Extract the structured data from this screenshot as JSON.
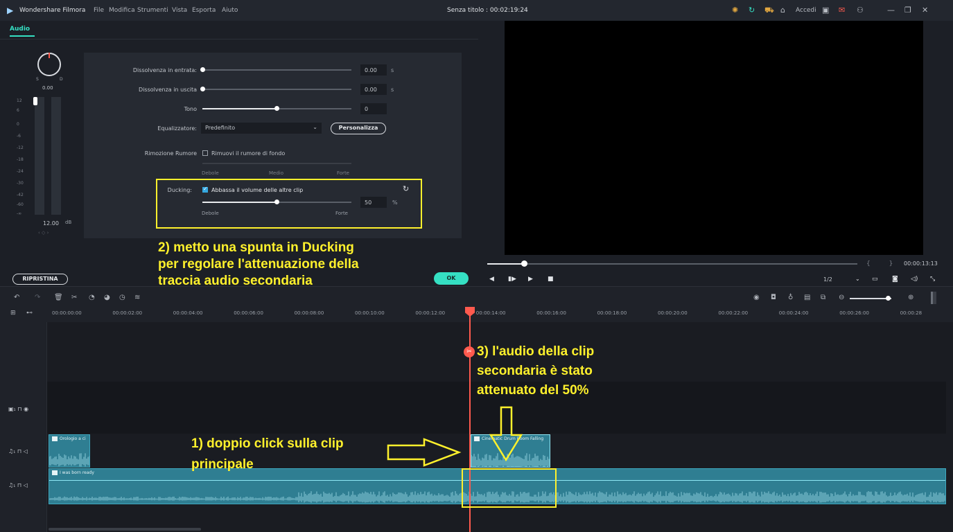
{
  "titlebar": {
    "app_name": "Wondershare Filmora",
    "menu": [
      "File",
      "Modifica",
      "Strumenti",
      "Vista",
      "Esporta",
      "Aiuto"
    ],
    "document_title": "Senza titolo : 00:02:19:24",
    "login_label": "Accedi"
  },
  "tabs": {
    "audio": "Audio"
  },
  "meter": {
    "left": "S",
    "right": "D",
    "pan_value": "0.00",
    "db_value": "12.00",
    "db_unit": "dB",
    "scale": [
      "12",
      "6",
      "0",
      "-6",
      "-12",
      "-18",
      "-24",
      "-30",
      "-42",
      "-60",
      "-∞"
    ]
  },
  "settings": {
    "fade_in": {
      "label": "Dissolvenza in entrata:",
      "value": "0.00",
      "unit": "s"
    },
    "fade_out": {
      "label": "Dissolvenza in uscita",
      "value": "0.00",
      "unit": "s"
    },
    "pitch": {
      "label": "Tono",
      "value": "0"
    },
    "equalizer": {
      "label": "Equalizzatore:",
      "value": "Predefinito",
      "button": "Personalizza"
    },
    "denoise": {
      "label": "Rimozione Rumore",
      "checkbox": "Rimuovi il rumore di fondo",
      "levels": [
        "Debole",
        "Medio",
        "Forte"
      ]
    },
    "ducking": {
      "label": "Ducking:",
      "checkbox": "Abbassa il volume delle altre clip",
      "value": "50",
      "unit": "%",
      "min": "Debole",
      "max": "Forte",
      "level": 0.5
    }
  },
  "buttons": {
    "reset": "RIPRISTINA",
    "ok": "OK"
  },
  "player": {
    "time": "00:00:13:13",
    "ratio": "1/2",
    "progress": 0.1
  },
  "ruler": [
    "00:00:00:00",
    "00:00:02:00",
    "00:00:04:00",
    "00:00:06:00",
    "00:00:08:00",
    "00:00:10:00",
    "00:00:12:00",
    "00:00:14:00",
    "00:00:16:00",
    "00:00:18:00",
    "00:00:20:00",
    "00:00:22:00",
    "00:00:24:00",
    "00:00:26:00",
    "00:00:28"
  ],
  "clips": {
    "clock": "Orologio a ci",
    "cinematic": "Cinematic Drum Boom Falling",
    "main": "I was born ready"
  },
  "annotations": {
    "note2": [
      "2) metto una spunta in Ducking",
      "per regolare l'attenuazione della",
      "traccia audio secondaria"
    ],
    "note3": [
      "3) l'audio della clip",
      "secondaria è stato",
      "attenuato del 50%"
    ],
    "note1": [
      "1) doppio click sulla clip",
      "principale"
    ],
    "color": "#fff12c"
  },
  "colors": {
    "accent": "#35e0c3",
    "playhead": "#ff5a4e",
    "clip": "#2f7e92"
  }
}
